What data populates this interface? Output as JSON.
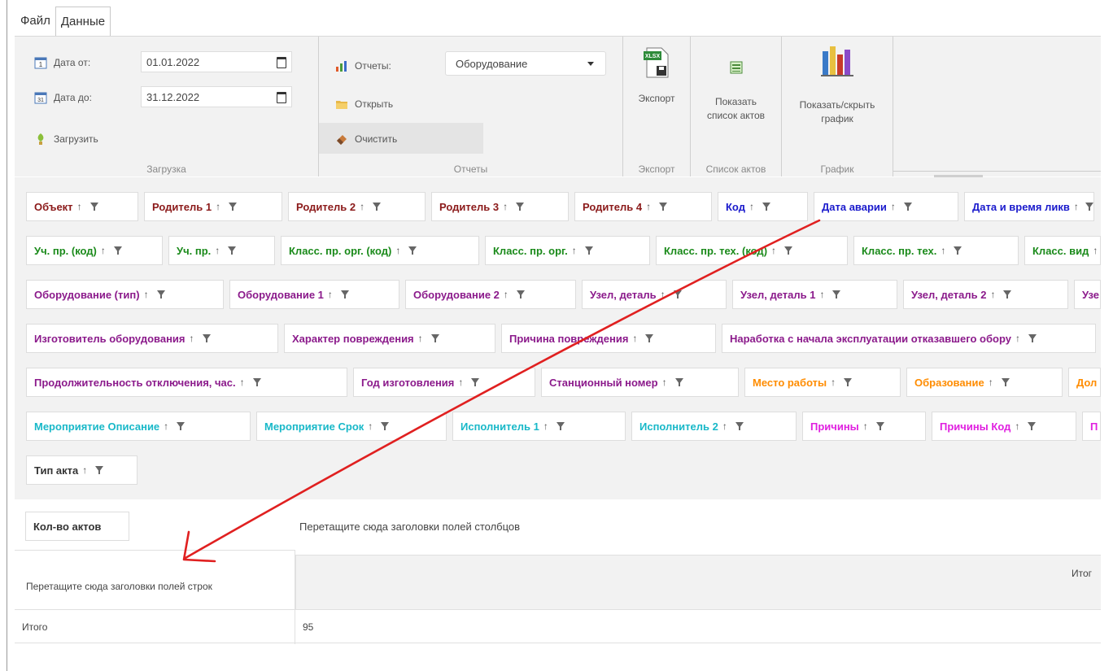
{
  "tabs": [
    "Файл",
    "Данные"
  ],
  "load": {
    "date_from_label": "Дата от:",
    "date_from": "01.01.2022",
    "date_to_label": "Дата до:",
    "date_to": "31.12.2022",
    "load_btn": "Загрузить",
    "group": "Загрузка"
  },
  "reports": {
    "label": "Отчеты:",
    "selected": "Оборудование",
    "open": "Открыть",
    "clear": "Очистить",
    "group": "Отчеты"
  },
  "export": {
    "btn": "Экспорт",
    "group": "Экспорт",
    "icon_text": "XLSX"
  },
  "acts": {
    "btn1": "Показать",
    "btn2": "список актов",
    "group": "Список актов"
  },
  "chart": {
    "btn1": "Показать/скрыть",
    "btn2": "график",
    "group": "График"
  },
  "field_rows": [
    [
      {
        "t": "Объект",
        "c": "#8B1A1A",
        "w": 138
      },
      {
        "t": "Родитель 1",
        "c": "#8B1A1A",
        "w": 170
      },
      {
        "t": "Родитель 2",
        "c": "#8B1A1A",
        "w": 169
      },
      {
        "t": "Родитель 3",
        "c": "#8B1A1A",
        "w": 169
      },
      {
        "t": "Родитель 4",
        "c": "#8B1A1A",
        "w": 169
      },
      {
        "t": "Код",
        "c": "#1a1acc",
        "w": 111
      },
      {
        "t": "Дата аварии",
        "c": "#1a1acc",
        "w": 178
      },
      {
        "t": "Дата и время ликв",
        "c": "#1a1acc",
        "w": 160
      }
    ],
    [
      {
        "t": "Уч. пр. (код)",
        "c": "#1a8a1a",
        "w": 168
      },
      {
        "t": "Уч. пр.",
        "c": "#1a8a1a",
        "w": 131
      },
      {
        "t": "Класс. пр. орг. (код)",
        "c": "#1a8a1a",
        "w": 244
      },
      {
        "t": "Класс. пр. орг.",
        "c": "#1a8a1a",
        "w": 203
      },
      {
        "t": "Класс. пр. тех. (код)",
        "c": "#1a8a1a",
        "w": 236
      },
      {
        "t": "Класс. пр. тех.",
        "c": "#1a8a1a",
        "w": 203
      },
      {
        "t": "Класс. вид",
        "c": "#1a8a1a",
        "w": 140
      }
    ],
    [
      {
        "t": "Оборудование (тип)",
        "c": "#8b1a8b",
        "w": 243
      },
      {
        "t": "Оборудование 1",
        "c": "#8b1a8b",
        "w": 209
      },
      {
        "t": "Оборудование 2",
        "c": "#8b1a8b",
        "w": 210
      },
      {
        "t": "Узел, деталь",
        "c": "#8b1a8b",
        "w": 178
      },
      {
        "t": "Узел, деталь 1",
        "c": "#8b1a8b",
        "w": 203
      },
      {
        "t": "Узел, деталь 2",
        "c": "#8b1a8b",
        "w": 203
      },
      {
        "t": "Узе",
        "c": "#8b1a8b",
        "w": 100
      }
    ],
    [
      {
        "t": "Изготовитель оборудования",
        "c": "#8b1a8b",
        "w": 310
      },
      {
        "t": "Характер повреждения",
        "c": "#8b1a8b",
        "w": 260
      },
      {
        "t": "Причина повреждения",
        "c": "#8b1a8b",
        "w": 264
      },
      {
        "t": "Наработка с начала эксплуатации отказавшего обору",
        "c": "#8b1a8b",
        "w": 460
      }
    ],
    [
      {
        "t": "Продолжительность отключения, час.",
        "c": "#8b1a8b",
        "w": 395
      },
      {
        "t": "Год изготовления",
        "c": "#8b1a8b",
        "w": 224
      },
      {
        "t": "Станционный номер",
        "c": "#8b1a8b",
        "w": 243
      },
      {
        "t": "Место работы",
        "c": "#ff8c00",
        "w": 192
      },
      {
        "t": "Образование",
        "c": "#ff8c00",
        "w": 192
      },
      {
        "t": "Дол",
        "c": "#ff8c00",
        "w": 100
      }
    ],
    [
      {
        "t": "Мероприятие Описание",
        "c": "#18b8c8",
        "w": 276
      },
      {
        "t": "Мероприятие Срок",
        "c": "#18b8c8",
        "w": 234
      },
      {
        "t": "Исполнитель 1",
        "c": "#18b8c8",
        "w": 213
      },
      {
        "t": "Исполнитель 2",
        "c": "#18b8c8",
        "w": 203
      },
      {
        "t": "Причины",
        "c": "#e020e0",
        "w": 152
      },
      {
        "t": "Причины Код",
        "c": "#e020e0",
        "w": 178
      },
      {
        "t": "П",
        "c": "#e020e0",
        "w": 60
      }
    ],
    [
      {
        "t": "Тип акта",
        "c": "#333333",
        "w": 137
      }
    ]
  ],
  "pivot": {
    "measure": "Кол-во актов",
    "col_drop": "Перетащите сюда заголовки полей столбцов",
    "row_drop": "Перетащите сюда заголовки полей строк",
    "col_total": "Итог",
    "total_label": "Итого",
    "total_value": "95"
  }
}
